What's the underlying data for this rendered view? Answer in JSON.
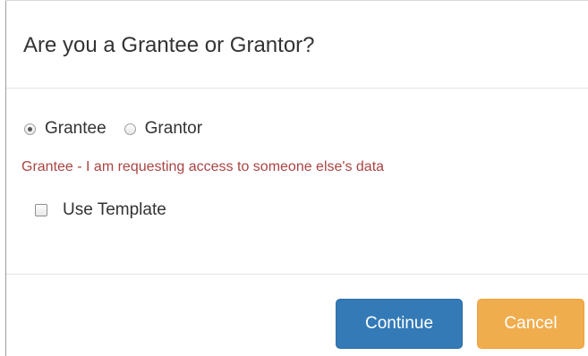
{
  "dialog": {
    "title": "Are you a Grantee or Grantor?"
  },
  "role_selector": {
    "options": [
      {
        "label": "Grantee",
        "checked": true
      },
      {
        "label": "Grantor",
        "checked": false
      }
    ],
    "help_text": "Grantee - I am requesting access to someone else's data"
  },
  "template": {
    "label": "Use Template",
    "checked": false
  },
  "footer": {
    "continue_label": "Continue",
    "cancel_label": "Cancel"
  },
  "colors": {
    "primary_button": "#337ab7",
    "warning_button": "#f0ad4e",
    "help_text": "#a94442",
    "title_text": "#333333"
  }
}
